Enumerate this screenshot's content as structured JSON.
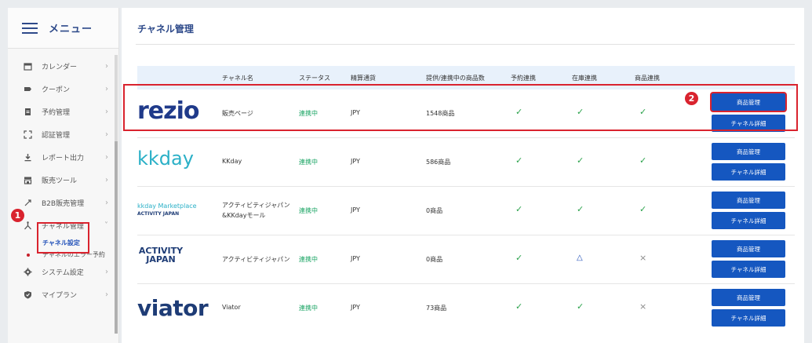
{
  "sidebar": {
    "menu_label": "メニュー",
    "items": [
      {
        "label": "カレンダー",
        "icon": "calendar-icon"
      },
      {
        "label": "クーポン",
        "icon": "coupon-icon"
      },
      {
        "label": "予約管理",
        "icon": "document-icon"
      },
      {
        "label": "認証管理",
        "icon": "scan-icon"
      },
      {
        "label": "レポート出力",
        "icon": "download-icon"
      },
      {
        "label": "販売ツール",
        "icon": "store-icon"
      },
      {
        "label": "B2B販売管理",
        "icon": "b2b-icon"
      },
      {
        "label": "チャネル管理",
        "icon": "channel-icon"
      }
    ],
    "sub_items": [
      {
        "label": "チャネル設定"
      },
      {
        "label": "チャネルのエラー予約"
      }
    ],
    "bottom_items": [
      {
        "label": "システム設定",
        "icon": "gear-icon"
      },
      {
        "label": "マイプラン",
        "icon": "shield-icon"
      }
    ]
  },
  "main": {
    "title": "チャネル管理",
    "columns": [
      "チャネル名",
      "ステータス",
      "精算通貨",
      "提供/連携中の商品数",
      "予約連携",
      "在庫連携",
      "商品連携"
    ],
    "rows": [
      {
        "logo": "rezio",
        "name": "販売ページ",
        "status": "連携中",
        "currency": "JPY",
        "count": "1548商品",
        "booking": "✓",
        "inventory": "✓",
        "product": "✓"
      },
      {
        "logo": "kkday",
        "name": "KKday",
        "status": "連携中",
        "currency": "JPY",
        "count": "586商品",
        "booking": "✓",
        "inventory": "✓",
        "product": "✓"
      },
      {
        "logo": "kkday-marketplace",
        "name": "アクティビティジャパン&KKdayモール",
        "name_line1": "アクティビティジャパン",
        "name_line2": "&KKdayモール",
        "status": "連携中",
        "currency": "JPY",
        "count": "0商品",
        "booking": "✓",
        "inventory": "✓",
        "product": "✓"
      },
      {
        "logo": "activity-japan",
        "name": "アクティビティジャパン",
        "status": "連携中",
        "currency": "JPY",
        "count": "0商品",
        "booking": "✓",
        "inventory": "△",
        "product": "×"
      },
      {
        "logo": "viator",
        "name": "Viator",
        "status": "連携中",
        "currency": "JPY",
        "count": "73商品",
        "booking": "✓",
        "inventory": "✓",
        "product": "×"
      }
    ],
    "buttons": {
      "product_manage": "商品管理",
      "channel_detail": "チャネル詳細"
    }
  },
  "logos": {
    "rezio": "rezio",
    "kkday": "kkday",
    "kkday_mp_top": "kkday Marketplace",
    "kkday_mp_bottom": "ACTIVITY JAPAN",
    "aj_top": "ACTIVITY",
    "aj_bottom": "JAPAN",
    "viator": "viator"
  },
  "annotations": {
    "badge1": "1",
    "badge2": "2"
  },
  "colors": {
    "accent": "#1557c0",
    "title": "#2e4a8a",
    "status": "#19a463",
    "highlight": "#d9232e"
  }
}
